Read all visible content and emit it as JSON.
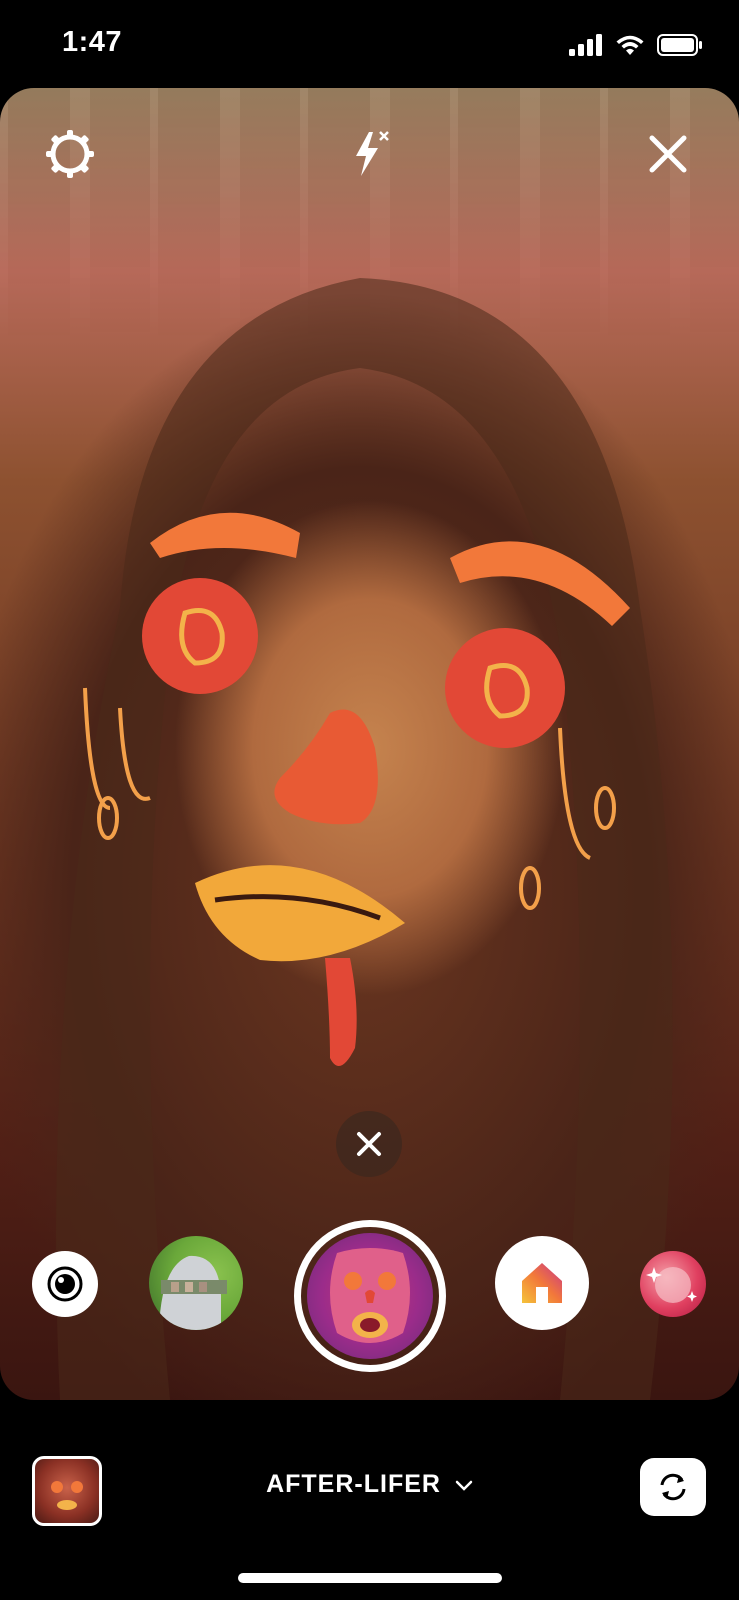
{
  "status_bar": {
    "time": "1:47",
    "icons": [
      "signal-icon",
      "wifi-icon",
      "battery-icon"
    ]
  },
  "camera": {
    "top_controls": [
      "settings-icon",
      "flash-off-icon",
      "close-icon"
    ],
    "remove_effect_icon": "close-icon",
    "effects": [
      {
        "name": "camera",
        "icon": "camera-lens-icon"
      },
      {
        "name": "face-effect"
      },
      {
        "name": "after-lifer",
        "selected": true
      },
      {
        "name": "home-effect",
        "icon": "home-icon"
      },
      {
        "name": "sparkle-effect"
      }
    ]
  },
  "bottom": {
    "effect_name": "AFTER-LIFER",
    "flip_icon": "flip-camera-icon"
  },
  "colors": {
    "accent_orange": "#f2783a",
    "accent_red": "#e24836",
    "accent_yellow": "#f3b34a"
  }
}
